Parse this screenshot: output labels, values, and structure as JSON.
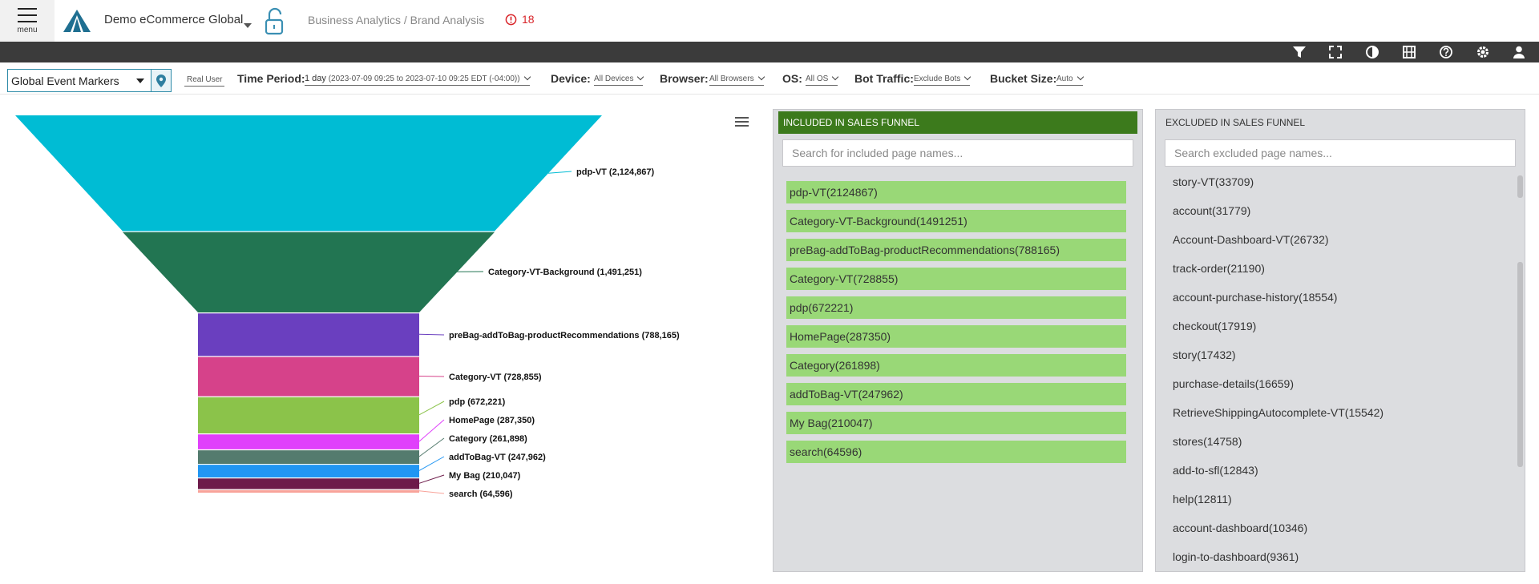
{
  "header": {
    "menu_label": "menu",
    "app_name": "Demo eCommerce Global",
    "breadcrumb": "Business Analytics / Brand Analysis",
    "alert_count": "18"
  },
  "toolbar": {
    "icons": [
      "filter-icon",
      "fullscreen-icon",
      "contrast-icon",
      "film-icon",
      "help-icon",
      "settings-icon",
      "user-icon"
    ]
  },
  "filters": {
    "marker_select": "Global Event Markers",
    "real_user": "Real User",
    "time_period_label": "Time Period:",
    "time_period_value": "1 day",
    "time_period_range": "(2023-07-09 09:25 to 2023-07-10 09:25 EDT (-04:00))",
    "device_label": "Device:",
    "device_value": "All Devices",
    "browser_label": "Browser:",
    "browser_value": "All Browsers",
    "os_label": "OS:",
    "os_value": "All OS",
    "bot_label": "Bot Traffic:",
    "bot_value": "Exclude Bots",
    "bucket_label": "Bucket Size:",
    "bucket_value": "Auto"
  },
  "chart_data": {
    "type": "funnel",
    "stages": [
      {
        "name": "pdp-VT",
        "value": 2124867,
        "label": "pdp-VT (2,124,867)",
        "color": "#00bcd4"
      },
      {
        "name": "Category-VT-Background",
        "value": 1491251,
        "label": "Category-VT-Background (1,491,251)",
        "color": "#227552"
      },
      {
        "name": "preBag-addToBag-productRecommendations",
        "value": 788165,
        "label": "preBag-addToBag-productRecommendations (788,165)",
        "color": "#6a3fbf"
      },
      {
        "name": "Category-VT",
        "value": 728855,
        "label": "Category-VT (728,855)",
        "color": "#d6428a"
      },
      {
        "name": "pdp",
        "value": 672221,
        "label": "pdp (672,221)",
        "color": "#8bc34a"
      },
      {
        "name": "HomePage",
        "value": 287350,
        "label": "HomePage (287,350)",
        "color": "#e040fb"
      },
      {
        "name": "Category",
        "value": 261898,
        "label": "Category (261,898)",
        "color": "#547b6e"
      },
      {
        "name": "addToBag-VT",
        "value": 247962,
        "label": "addToBag-VT (247,962)",
        "color": "#2196f3"
      },
      {
        "name": "My Bag",
        "value": 210047,
        "label": "My Bag (210,047)",
        "color": "#6d1b4a"
      },
      {
        "name": "search",
        "value": 64596,
        "label": "search (64,596)",
        "color": "#f8a39a"
      }
    ]
  },
  "included_panel": {
    "title": "INCLUDED IN SALES FUNNEL",
    "search_placeholder": "Search for included page names...",
    "items": [
      "pdp-VT(2124867)",
      "Category-VT-Background(1491251)",
      "preBag-addToBag-productRecommendations(788165)",
      "Category-VT(728855)",
      "pdp(672221)",
      "HomePage(287350)",
      "Category(261898)",
      "addToBag-VT(247962)",
      "My Bag(210047)",
      "search(64596)"
    ]
  },
  "excluded_panel": {
    "title": "EXCLUDED IN SALES FUNNEL",
    "search_placeholder": "Search excluded page names...",
    "items": [
      "story-VT(33709)",
      "account(31779)",
      "Account-Dashboard-VT(26732)",
      "track-order(21190)",
      "account-purchase-history(18554)",
      "checkout(17919)",
      "story(17432)",
      "purchase-details(16659)",
      "RetrieveShippingAutocomplete-VT(15542)",
      "stores(14758)",
      "add-to-sfl(12843)",
      "help(12811)",
      "account-dashboard(10346)",
      "login-to-dashboard(9361)"
    ]
  }
}
